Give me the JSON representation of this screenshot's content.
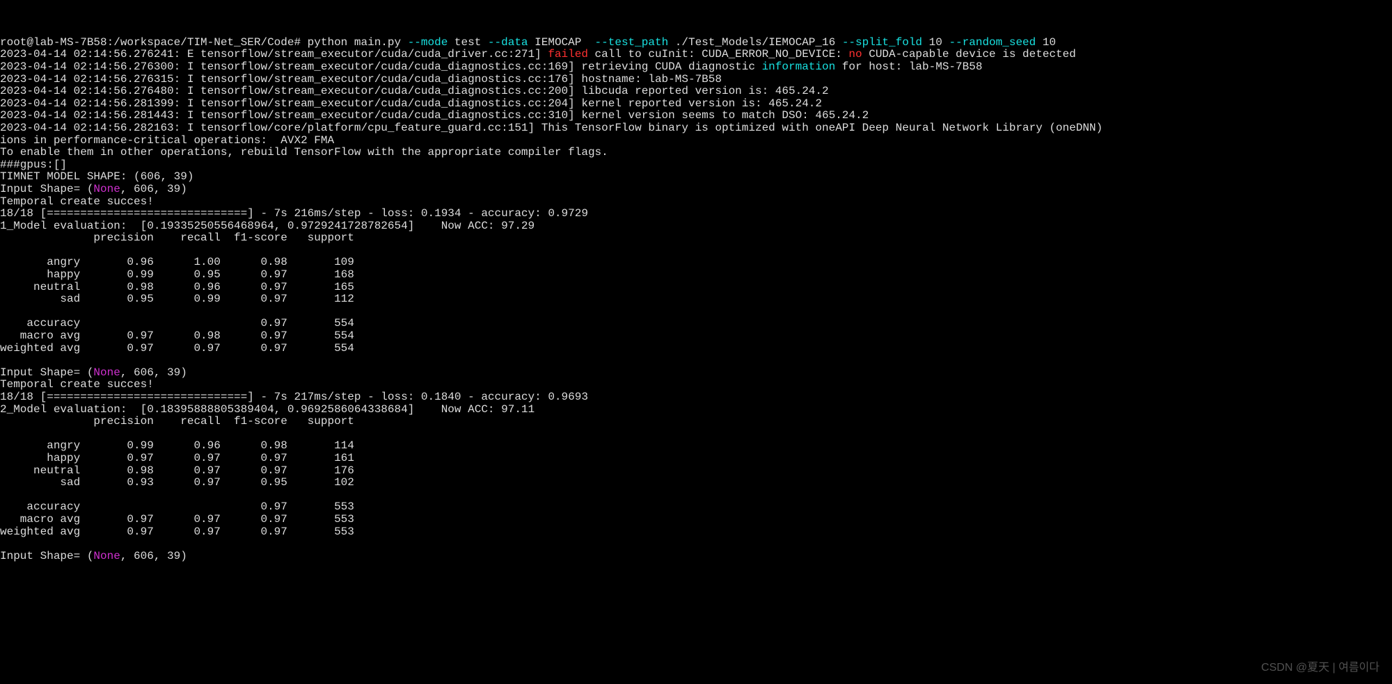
{
  "prompt": {
    "path": "root@lab-MS-7B58:/workspace/TIM-Net_SER/Code# ",
    "cmd": "python main.py ",
    "f_mode": "--mode",
    "v_mode": " test ",
    "f_data": "--data",
    "v_data": " IEMOCAP  ",
    "f_tp": "--test_path",
    "v_tp": " ./Test_Models/IEMOCAP_16 ",
    "f_sf": "--split_fold",
    "v_sf": " 10 ",
    "f_rs": "--random_seed",
    "v_rs": " 10"
  },
  "log": {
    "l1a": "2023-04-14 02:14:56.276241: E tensorflow/stream_executor/cuda/cuda_driver.cc:271] ",
    "l1b": "failed",
    "l1c": " call to cuInit: CUDA_ERROR_NO_DEVICE: ",
    "l1d": "no",
    "l1e": " CUDA-capable device is detected",
    "l2a": "2023-04-14 02:14:56.276300: I tensorflow/stream_executor/cuda/cuda_diagnostics.cc:169] retrieving CUDA diagnostic ",
    "l2b": "information",
    "l2c": " for host: lab-MS-7B58",
    "l3": "2023-04-14 02:14:56.276315: I tensorflow/stream_executor/cuda/cuda_diagnostics.cc:176] hostname: lab-MS-7B58",
    "l4": "2023-04-14 02:14:56.276480: I tensorflow/stream_executor/cuda/cuda_diagnostics.cc:200] libcuda reported version is: 465.24.2",
    "l5": "2023-04-14 02:14:56.281399: I tensorflow/stream_executor/cuda/cuda_diagnostics.cc:204] kernel reported version is: 465.24.2",
    "l6": "2023-04-14 02:14:56.281443: I tensorflow/stream_executor/cuda/cuda_diagnostics.cc:310] kernel version seems to match DSO: 465.24.2",
    "l7": "2023-04-14 02:14:56.282163: I tensorflow/core/platform/cpu_feature_guard.cc:151] This TensorFlow binary is optimized with oneAPI Deep Neural Network Library (oneDNN) ",
    "l8": "ions in performance-critical operations:  AVX2 FMA",
    "l9": "To enable them in other operations, rebuild TensorFlow with the appropriate compiler flags.",
    "gpus": "###gpus:[]",
    "shape": "TIMNET MODEL SHAPE: (606, 39)"
  },
  "in1": {
    "a": "Input Shape= (",
    "none": "None",
    "b": ", 606, 39)"
  },
  "tc": "Temporal create succes!",
  "eval1": {
    "prog": "18/18 [==============================] - 7s 216ms/step - loss: 0.1934 - accuracy: 0.9729",
    "line": "1_Model evaluation:  [0.19335250556468964, 0.9729241728782654]    Now ACC: 97.29",
    "hdr": "              precision    recall  f1-score   support",
    "r1": "       angry       0.96      1.00      0.98       109",
    "r2": "       happy       0.99      0.95      0.97       168",
    "r3": "     neutral       0.98      0.96      0.97       165",
    "r4": "         sad       0.95      0.99      0.97       112",
    "acc": "    accuracy                           0.97       554",
    "mac": "   macro avg       0.97      0.98      0.97       554",
    "wav": "weighted avg       0.97      0.97      0.97       554"
  },
  "eval2": {
    "prog": "18/18 [==============================] - 7s 217ms/step - loss: 0.1840 - accuracy: 0.9693",
    "line": "2_Model evaluation:  [0.18395888805389404, 0.9692586064338684]    Now ACC: 97.11",
    "hdr": "              precision    recall  f1-score   support",
    "r1": "       angry       0.99      0.96      0.98       114",
    "r2": "       happy       0.97      0.97      0.97       161",
    "r3": "     neutral       0.98      0.97      0.97       176",
    "r4": "         sad       0.93      0.97      0.95       102",
    "acc": "    accuracy                           0.97       553",
    "mac": "   macro avg       0.97      0.97      0.97       553",
    "wav": "weighted avg       0.97      0.97      0.97       553"
  },
  "watermark": "CSDN @夏天 | 여름이다"
}
